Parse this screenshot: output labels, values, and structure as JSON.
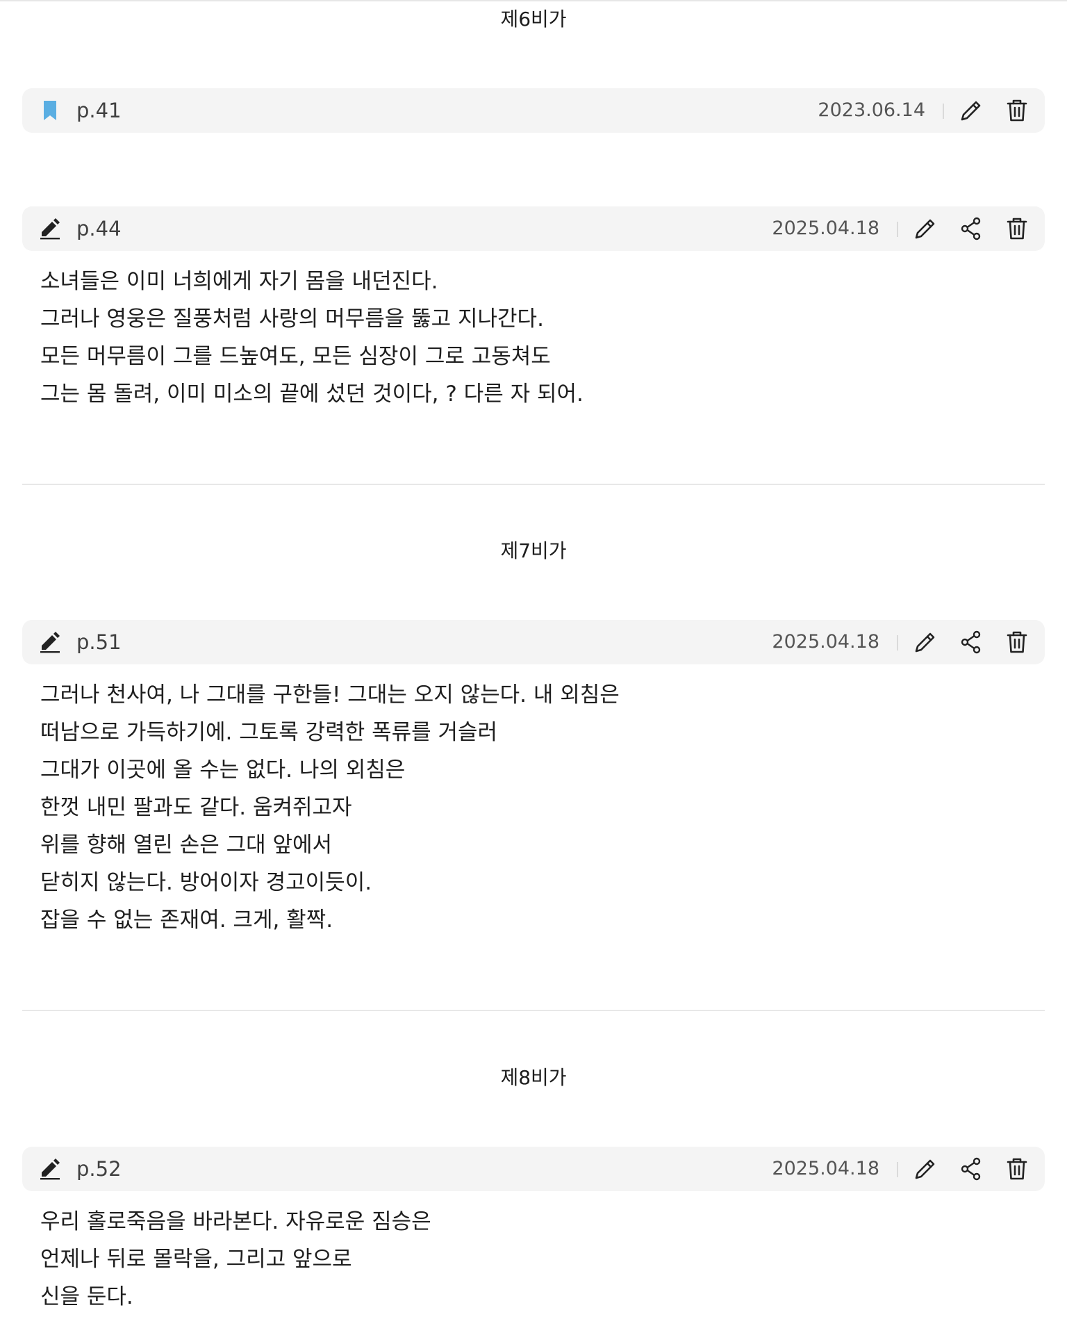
{
  "sections": [
    {
      "title": "제6비가",
      "entries": [
        {
          "type": "bookmark",
          "icon": "bookmark-icon",
          "page": "p.41",
          "date": "2023.06.14",
          "actions": [
            "edit-icon",
            "trash-icon"
          ],
          "lines": []
        },
        {
          "type": "note",
          "icon": "pen-icon",
          "page": "p.44",
          "date": "2025.04.18",
          "actions": [
            "edit-icon",
            "share-icon",
            "trash-icon"
          ],
          "lines": [
            "소녀들은 이미 너희에게 자기 몸을 내던진다.",
            "그러나 영웅은 질풍처럼 사랑의 머무름을 뚫고 지나간다.",
            "모든 머무름이 그를 드높여도, 모든 심장이 그로 고동쳐도",
            "그는 몸 돌려, 이미 미소의 끝에 섰던 것이다, ? 다른 자 되어."
          ]
        }
      ]
    },
    {
      "title": "제7비가",
      "entries": [
        {
          "type": "note",
          "icon": "pen-icon",
          "page": "p.51",
          "date": "2025.04.18",
          "actions": [
            "edit-icon",
            "share-icon",
            "trash-icon"
          ],
          "lines": [
            "그러나 천사여, 나 그대를 구한들! 그대는 오지 않는다. 내 외침은",
            "떠남으로 가득하기에. 그토록 강력한 폭류를 거슬러",
            "그대가 이곳에 올 수는 없다. 나의 외침은",
            "한껏 내민 팔과도 같다. 움켜쥐고자",
            "위를 향해 열린 손은 그대 앞에서",
            "닫히지 않는다. 방어이자 경고이듯이.",
            "잡을 수 없는 존재여. 크게, 활짝."
          ]
        }
      ]
    },
    {
      "title": "제8비가",
      "entries": [
        {
          "type": "note",
          "icon": "pen-icon",
          "page": "p.52",
          "date": "2025.04.18",
          "actions": [
            "edit-icon",
            "share-icon",
            "trash-icon"
          ],
          "lines": [
            "우리 홀로죽음을 바라본다. 자유로운 짐승은",
            "언제나 뒤로 몰락을, 그리고 앞으로",
            "신을 둔다."
          ]
        }
      ]
    }
  ],
  "colors": {
    "bookmark": "#5aaee2",
    "bar_background": "#f4f4f4",
    "divider": "#e8e8e8",
    "icon": "#222222"
  }
}
